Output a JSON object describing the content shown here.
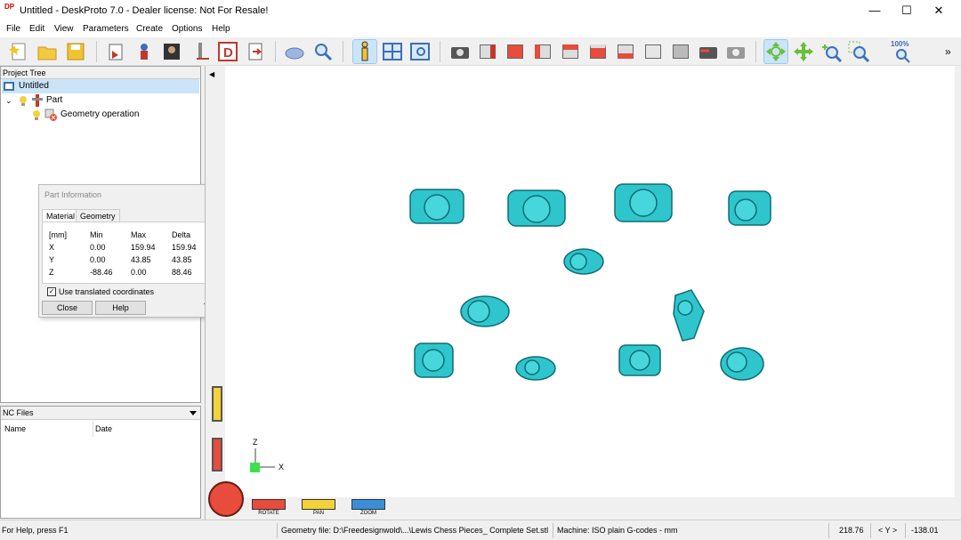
{
  "window": {
    "title": "Untitled - DeskProto 7.0 - Dealer license: Not For Resale!",
    "logo": "DP"
  },
  "menu": [
    "File",
    "Edit",
    "View",
    "Parameters",
    "Create",
    "Options",
    "Help"
  ],
  "toolbar": {
    "zoom_label": "100%"
  },
  "project_tree": {
    "header": "Project Tree",
    "root": "Untitled",
    "part": "Part",
    "operation": "Geometry operation"
  },
  "part_info": {
    "title": "Part Information",
    "tabs": [
      "Material",
      "Geometry"
    ],
    "headers": [
      "[mm]",
      "Min",
      "Max",
      "Delta"
    ],
    "rows": [
      [
        "X",
        "0.00",
        "159.94",
        "159.94"
      ],
      [
        "Y",
        "0.00",
        "43.85",
        "43.85"
      ],
      [
        "Z",
        "-88.46",
        "0.00",
        "88.46"
      ]
    ],
    "checkbox_label": "Use translated coordinates",
    "close": "Close",
    "help": "Help"
  },
  "nc_files": {
    "header": "NC Files",
    "col_name": "Name",
    "col_date": "Date"
  },
  "axes": {
    "z": "Z",
    "x": "X"
  },
  "view_controls": {
    "rotate": "ROTATE",
    "pan": "PAN",
    "zoom": "ZOOM"
  },
  "status": {
    "help": "For Help, press F1",
    "geometry": "Geometry file: D:\\Freedesignwold\\...\\Lewis Chess Pieces_ Complete Set.stl",
    "machine": "Machine: ISO plain G-codes - mm",
    "x": "218.76",
    "axis": "< Y >",
    "y": "-138.01"
  },
  "colors": {
    "model": "#2fc5cc",
    "model_dark": "#0d6e74",
    "selection": "#cce4f7"
  }
}
